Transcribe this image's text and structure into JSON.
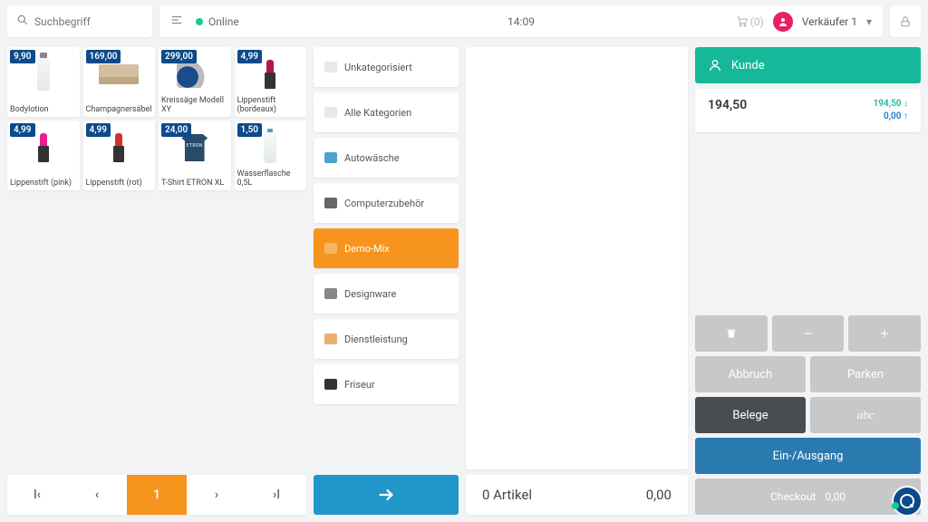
{
  "search": {
    "placeholder": "Suchbegriff"
  },
  "header": {
    "status": "Online",
    "time": "14:09",
    "cart_count": "(0)",
    "user": "Verkäufer 1"
  },
  "products": [
    {
      "price": "9,90",
      "name": "Bodylotion"
    },
    {
      "price": "169,00",
      "name": "Champagnersäbel"
    },
    {
      "price": "299,00",
      "name": "Kreissäge Modell XY"
    },
    {
      "price": "4,99",
      "name": "Lippenstift (bordeaux)"
    },
    {
      "price": "4,99",
      "name": "Lippenstift (pink)"
    },
    {
      "price": "4,99",
      "name": "Lippenstift (rot)"
    },
    {
      "price": "24,00",
      "name": "T-Shirt ETRON XL"
    },
    {
      "price": "1,50",
      "name": "Wasserflasche 0,5L"
    }
  ],
  "pagination": {
    "current": "1"
  },
  "categories": {
    "items": [
      {
        "label": "Unkategorisiert"
      },
      {
        "label": "Alle Kategorien"
      },
      {
        "label": "Autowäsche"
      },
      {
        "label": "Computerzubehör"
      },
      {
        "label": "Demo-Mix"
      },
      {
        "label": "Designware"
      },
      {
        "label": "Dienstleistung"
      },
      {
        "label": "Friseur"
      }
    ]
  },
  "cart_summary": {
    "count_label": "0 Artikel",
    "total": "0,00"
  },
  "side": {
    "kunde": "Kunde",
    "balance_total": "194,50",
    "balance_down": "194,50",
    "balance_up": "0,00",
    "buttons": {
      "abbruch": "Abbruch",
      "parken": "Parken",
      "belege": "Belege",
      "abc": "abc",
      "einausg": "Ein-/Ausgang",
      "checkout": "Checkout",
      "checkout_amount": "0,00"
    }
  }
}
